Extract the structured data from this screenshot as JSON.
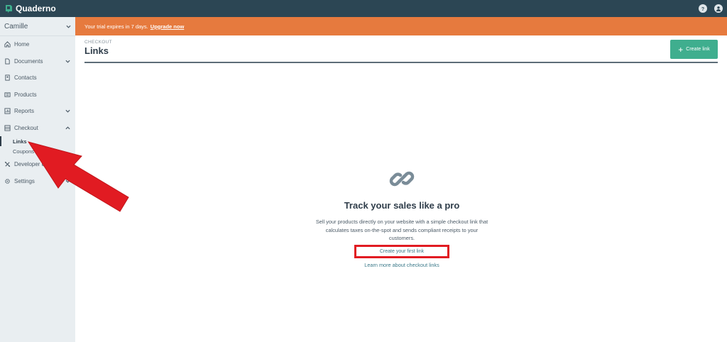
{
  "app": {
    "name": "Quaderno"
  },
  "topbar": {
    "help_icon": "question-icon",
    "user_icon": "user-icon"
  },
  "sidebar": {
    "account": "Camille",
    "items": [
      {
        "label": "Home",
        "icon": "home-icon"
      },
      {
        "label": "Documents",
        "icon": "document-icon",
        "has_chevron": true
      },
      {
        "label": "Contacts",
        "icon": "contacts-icon"
      },
      {
        "label": "Products",
        "icon": "products-icon"
      },
      {
        "label": "Reports",
        "icon": "reports-icon",
        "has_chevron": true
      },
      {
        "label": "Checkout",
        "icon": "checkout-icon",
        "expanded": true
      },
      {
        "label": "Developer docs",
        "icon": "developer-icon"
      },
      {
        "label": "Settings",
        "icon": "gear-icon",
        "has_chevron": true
      }
    ],
    "checkout_sub": [
      {
        "label": "Links",
        "active": true
      },
      {
        "label": "Coupons",
        "active": false
      }
    ]
  },
  "banner": {
    "text": "Your trial expires in 7 days.",
    "link": "Upgrade now"
  },
  "header": {
    "breadcrumb": "CHECKOUT",
    "title": "Links",
    "create_button": "Create link"
  },
  "empty_state": {
    "title": "Track your sales like a pro",
    "description": "Sell your products directly on your website with a simple checkout link that calculates taxes on-the-spot and sends compliant receipts to your customers.",
    "cta": "Create your first link",
    "learn_more": "Learn more about checkout links"
  },
  "colors": {
    "topbar": "#2c4654",
    "banner": "#e67a3e",
    "accent": "#3fae8e",
    "annotation": "#e11b22"
  }
}
